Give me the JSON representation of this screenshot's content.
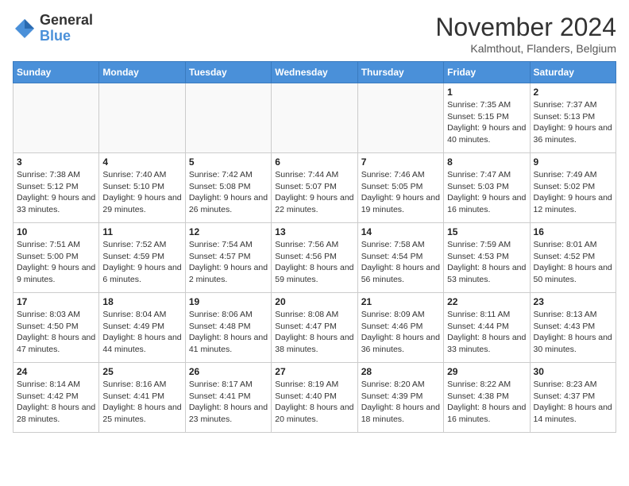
{
  "logo": {
    "general": "General",
    "blue": "Blue"
  },
  "header": {
    "month": "November 2024",
    "location": "Kalmthout, Flanders, Belgium"
  },
  "weekdays": [
    "Sunday",
    "Monday",
    "Tuesday",
    "Wednesday",
    "Thursday",
    "Friday",
    "Saturday"
  ],
  "weeks": [
    [
      {
        "day": "",
        "info": ""
      },
      {
        "day": "",
        "info": ""
      },
      {
        "day": "",
        "info": ""
      },
      {
        "day": "",
        "info": ""
      },
      {
        "day": "",
        "info": ""
      },
      {
        "day": "1",
        "info": "Sunrise: 7:35 AM\nSunset: 5:15 PM\nDaylight: 9 hours and 40 minutes."
      },
      {
        "day": "2",
        "info": "Sunrise: 7:37 AM\nSunset: 5:13 PM\nDaylight: 9 hours and 36 minutes."
      }
    ],
    [
      {
        "day": "3",
        "info": "Sunrise: 7:38 AM\nSunset: 5:12 PM\nDaylight: 9 hours and 33 minutes."
      },
      {
        "day": "4",
        "info": "Sunrise: 7:40 AM\nSunset: 5:10 PM\nDaylight: 9 hours and 29 minutes."
      },
      {
        "day": "5",
        "info": "Sunrise: 7:42 AM\nSunset: 5:08 PM\nDaylight: 9 hours and 26 minutes."
      },
      {
        "day": "6",
        "info": "Sunrise: 7:44 AM\nSunset: 5:07 PM\nDaylight: 9 hours and 22 minutes."
      },
      {
        "day": "7",
        "info": "Sunrise: 7:46 AM\nSunset: 5:05 PM\nDaylight: 9 hours and 19 minutes."
      },
      {
        "day": "8",
        "info": "Sunrise: 7:47 AM\nSunset: 5:03 PM\nDaylight: 9 hours and 16 minutes."
      },
      {
        "day": "9",
        "info": "Sunrise: 7:49 AM\nSunset: 5:02 PM\nDaylight: 9 hours and 12 minutes."
      }
    ],
    [
      {
        "day": "10",
        "info": "Sunrise: 7:51 AM\nSunset: 5:00 PM\nDaylight: 9 hours and 9 minutes."
      },
      {
        "day": "11",
        "info": "Sunrise: 7:52 AM\nSunset: 4:59 PM\nDaylight: 9 hours and 6 minutes."
      },
      {
        "day": "12",
        "info": "Sunrise: 7:54 AM\nSunset: 4:57 PM\nDaylight: 9 hours and 2 minutes."
      },
      {
        "day": "13",
        "info": "Sunrise: 7:56 AM\nSunset: 4:56 PM\nDaylight: 8 hours and 59 minutes."
      },
      {
        "day": "14",
        "info": "Sunrise: 7:58 AM\nSunset: 4:54 PM\nDaylight: 8 hours and 56 minutes."
      },
      {
        "day": "15",
        "info": "Sunrise: 7:59 AM\nSunset: 4:53 PM\nDaylight: 8 hours and 53 minutes."
      },
      {
        "day": "16",
        "info": "Sunrise: 8:01 AM\nSunset: 4:52 PM\nDaylight: 8 hours and 50 minutes."
      }
    ],
    [
      {
        "day": "17",
        "info": "Sunrise: 8:03 AM\nSunset: 4:50 PM\nDaylight: 8 hours and 47 minutes."
      },
      {
        "day": "18",
        "info": "Sunrise: 8:04 AM\nSunset: 4:49 PM\nDaylight: 8 hours and 44 minutes."
      },
      {
        "day": "19",
        "info": "Sunrise: 8:06 AM\nSunset: 4:48 PM\nDaylight: 8 hours and 41 minutes."
      },
      {
        "day": "20",
        "info": "Sunrise: 8:08 AM\nSunset: 4:47 PM\nDaylight: 8 hours and 38 minutes."
      },
      {
        "day": "21",
        "info": "Sunrise: 8:09 AM\nSunset: 4:46 PM\nDaylight: 8 hours and 36 minutes."
      },
      {
        "day": "22",
        "info": "Sunrise: 8:11 AM\nSunset: 4:44 PM\nDaylight: 8 hours and 33 minutes."
      },
      {
        "day": "23",
        "info": "Sunrise: 8:13 AM\nSunset: 4:43 PM\nDaylight: 8 hours and 30 minutes."
      }
    ],
    [
      {
        "day": "24",
        "info": "Sunrise: 8:14 AM\nSunset: 4:42 PM\nDaylight: 8 hours and 28 minutes."
      },
      {
        "day": "25",
        "info": "Sunrise: 8:16 AM\nSunset: 4:41 PM\nDaylight: 8 hours and 25 minutes."
      },
      {
        "day": "26",
        "info": "Sunrise: 8:17 AM\nSunset: 4:41 PM\nDaylight: 8 hours and 23 minutes."
      },
      {
        "day": "27",
        "info": "Sunrise: 8:19 AM\nSunset: 4:40 PM\nDaylight: 8 hours and 20 minutes."
      },
      {
        "day": "28",
        "info": "Sunrise: 8:20 AM\nSunset: 4:39 PM\nDaylight: 8 hours and 18 minutes."
      },
      {
        "day": "29",
        "info": "Sunrise: 8:22 AM\nSunset: 4:38 PM\nDaylight: 8 hours and 16 minutes."
      },
      {
        "day": "30",
        "info": "Sunrise: 8:23 AM\nSunset: 4:37 PM\nDaylight: 8 hours and 14 minutes."
      }
    ]
  ]
}
